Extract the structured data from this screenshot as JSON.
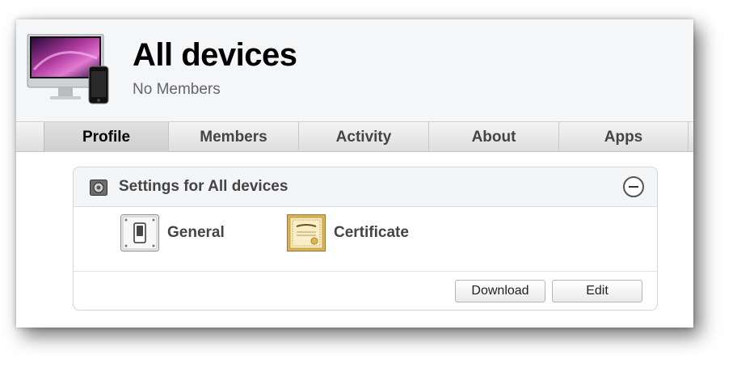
{
  "header": {
    "title": "All devices",
    "subtitle": "No Members",
    "icon": "imac-iphone-icon"
  },
  "tabs": [
    {
      "label": "Profile",
      "active": true
    },
    {
      "label": "Members",
      "active": false
    },
    {
      "label": "Activity",
      "active": false
    },
    {
      "label": "About",
      "active": false
    },
    {
      "label": "Apps",
      "active": false
    }
  ],
  "settings": {
    "title": "Settings for All devices",
    "payloads": [
      {
        "label": "General",
        "icon": "switch-icon"
      },
      {
        "label": "Certificate",
        "icon": "certificate-icon"
      }
    ],
    "buttons": {
      "download_label": "Download",
      "edit_label": "Edit"
    }
  },
  "colors": {
    "header_bg": "#f5f6f7",
    "tab_active_bg": "#d6d6d6",
    "text_dark": "#444444",
    "subtitle": "#666666"
  }
}
